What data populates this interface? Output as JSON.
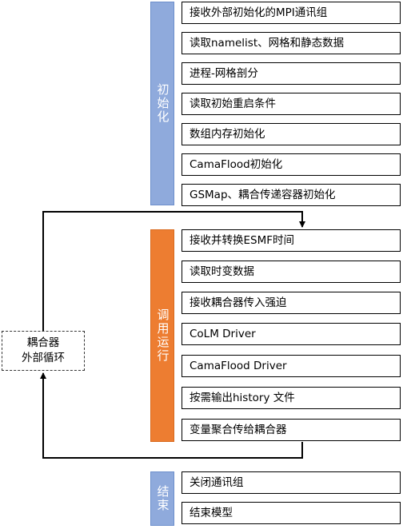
{
  "sections": [
    {
      "label": "初始化",
      "color": "#8faadc",
      "steps": [
        "接收外部初始化的MPI通讯组",
        "读取namelist、网格和静态数据",
        "进程-网格剖分",
        "读取初始重启条件",
        "数组内存初始化",
        "CamaFlood初始化",
        "GSMap、耦合传递容器初始化"
      ]
    },
    {
      "label": "调用运行",
      "color": "#ed7d31",
      "steps": [
        "接收并转换ESMF时间",
        "读取时变数据",
        "接收耦合器传入强迫",
        "CoLM Driver",
        "CamaFlood Driver",
        "按需输出history 文件",
        "变量聚合传给耦合器"
      ]
    },
    {
      "label": "结束",
      "color": "#8faadc",
      "steps": [
        "关闭通讯组",
        "结束模型"
      ]
    }
  ],
  "loop": {
    "line1": "耦合器",
    "line2": "外部循环"
  }
}
